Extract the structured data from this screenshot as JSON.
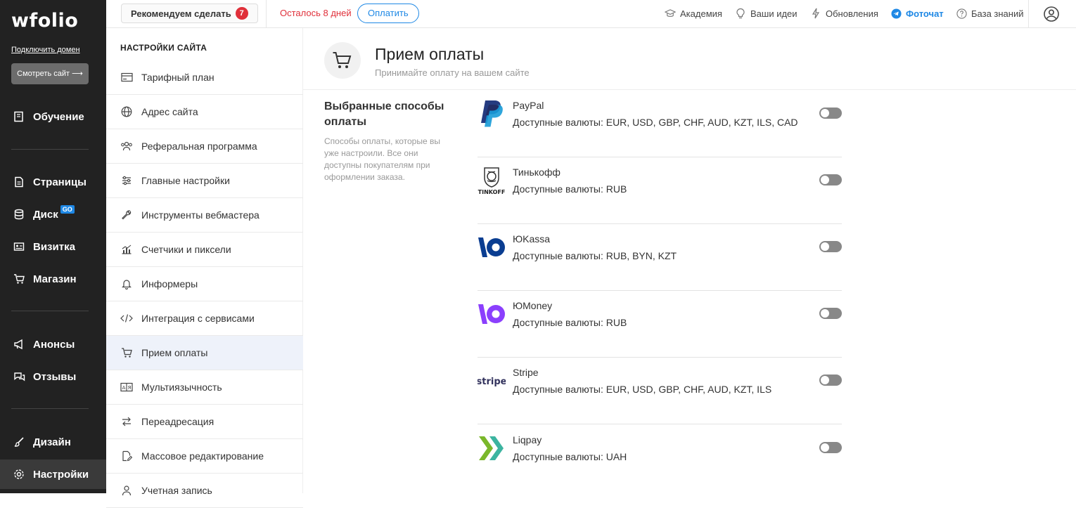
{
  "sidebar": {
    "logo": "wfolio",
    "connect_domain": "Подключить домен",
    "view_site": "Смотреть сайт ⟶",
    "items": [
      {
        "label": "Обучение",
        "icon": "book-icon"
      },
      {
        "label": "Страницы",
        "icon": "page-icon"
      },
      {
        "label": "Диск",
        "icon": "disk-icon",
        "badge": "GO"
      },
      {
        "label": "Визитка",
        "icon": "card-icon"
      },
      {
        "label": "Магазин",
        "icon": "cart-icon"
      },
      {
        "label": "Анонсы",
        "icon": "megaphone-icon"
      },
      {
        "label": "Отзывы",
        "icon": "chat-icon"
      },
      {
        "label": "Дизайн",
        "icon": "brush-icon"
      },
      {
        "label": "Настройки",
        "icon": "gear-icon",
        "active": true
      }
    ]
  },
  "topbar": {
    "recommend_label": "Рекомендуем сделать",
    "recommend_count": "7",
    "days_left": "Осталось 8 дней",
    "pay_label": "Оплатить",
    "links": [
      {
        "label": "Академия",
        "icon": "graduation-cap-icon"
      },
      {
        "label": "Ваши идеи",
        "icon": "lightbulb-icon"
      },
      {
        "label": "Обновления",
        "icon": "lightning-icon"
      },
      {
        "label": "Фотоchат",
        "icon": "telegram-icon"
      },
      {
        "label": "База знаний",
        "icon": "question-icon"
      }
    ]
  },
  "settings": {
    "title": "НАСТРОЙКИ САЙТА",
    "items": [
      {
        "label": "Тарифный план",
        "icon": "credit-card-icon"
      },
      {
        "label": "Адрес сайта",
        "icon": "globe-icon"
      },
      {
        "label": "Реферальная программа",
        "icon": "users-icon"
      },
      {
        "label": "Главные настройки",
        "icon": "sliders-icon"
      },
      {
        "label": "Инструменты вебмастера",
        "icon": "wrench-icon"
      },
      {
        "label": "Счетчики и пиксели",
        "icon": "chart-icon"
      },
      {
        "label": "Информеры",
        "icon": "bell-icon"
      },
      {
        "label": "Интеграция с сервисами",
        "icon": "code-icon"
      },
      {
        "label": "Прием оплаты",
        "icon": "cart-icon",
        "active": true
      },
      {
        "label": "Мультиязычность",
        "icon": "language-icon"
      },
      {
        "label": "Переадресация",
        "icon": "arrows-icon"
      },
      {
        "label": "Массовое редактирование",
        "icon": "edit-file-icon"
      },
      {
        "label": "Учетная запись",
        "icon": "user-icon"
      }
    ]
  },
  "main": {
    "title": "Прием оплаты",
    "subtitle": "Принимайте оплату на вашем сайте",
    "section_title": "Выбранные способы оплаты",
    "section_desc": "Способы оплаты, которые вы уже настроили. Все они доступны покупателям при оформлении заказа.",
    "methods": [
      {
        "name": "PayPal",
        "currencies": "Доступные валюты: EUR, USD, GBP, CHF, AUD, KZT, ILS, CAD",
        "logo": "paypal-logo",
        "enabled": false
      },
      {
        "name": "Тинькофф",
        "currencies": "Доступные валюты: RUB",
        "logo": "tinkoff-logo",
        "enabled": false
      },
      {
        "name": "ЮKassa",
        "currencies": "Доступные валюты: RUB, BYN, KZT",
        "logo": "yookassa-logo",
        "enabled": false
      },
      {
        "name": "ЮMoney",
        "currencies": "Доступные валюты: RUB",
        "logo": "yoomoney-logo",
        "enabled": false
      },
      {
        "name": "Stripe",
        "currencies": "Доступные валюты: EUR, USD, GBP, CHF, AUD, KZT, ILS",
        "logo": "stripe-logo",
        "enabled": false
      },
      {
        "name": "Liqpay",
        "currencies": "Доступные валюты: UAH",
        "logo": "liqpay-logo",
        "enabled": false
      }
    ]
  },
  "colors": {
    "sidebar_bg": "#222222",
    "accent_blue": "#1e88e5",
    "alert_red": "#e0303a",
    "toggle_off": "#888888"
  }
}
